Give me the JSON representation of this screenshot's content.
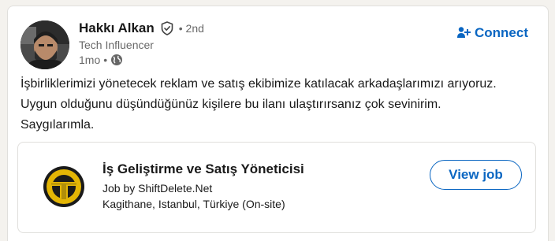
{
  "actor": {
    "name": "Hakkı Alkan",
    "degree": "• 2nd",
    "headline": "Tech Influencer",
    "time": "1mo",
    "dot": "•",
    "verified_icon": "verified-shield-icon",
    "visibility_icon": "globe-icon"
  },
  "connect": {
    "label": "Connect",
    "icon": "add-person-icon",
    "color": "#0a66c2"
  },
  "post": {
    "lines": [
      "İşbirliklerimizi yönetecek reklam ve satış ekibimize katılacak arkadaşlarımızı arıyoruz.",
      "Uygun olduğunu düşündüğünüz kişilere bu ilanı ulaştırırsanız çok sevinirim.",
      "Saygılarımla."
    ]
  },
  "job": {
    "title": "İş Geliştirme ve Satış Yöneticisi",
    "company": "Job by ShiftDelete.Net",
    "location": "Kagithane, Istanbul, Türkiye (On-site)",
    "button_label": "View job",
    "logo": "shiftdelete-logo"
  }
}
